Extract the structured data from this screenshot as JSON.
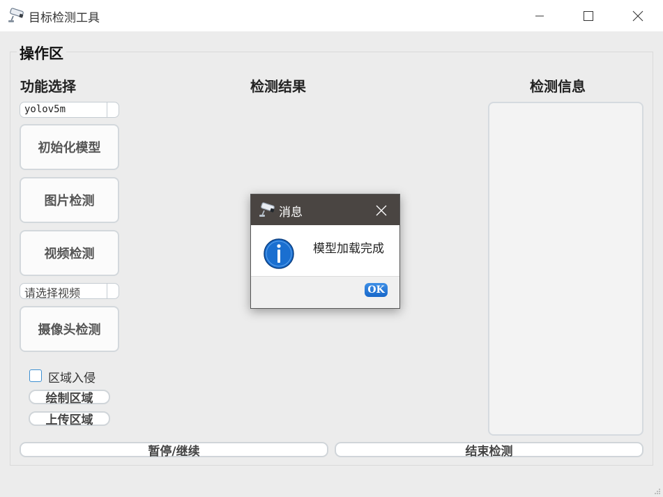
{
  "window": {
    "title": "目标检测工具",
    "icon": "security-camera-icon"
  },
  "group": {
    "title": "操作区"
  },
  "sections": {
    "function_select": "功能选择",
    "detect_result": "检测结果",
    "detect_info": "检测信息"
  },
  "controls": {
    "model_combo": "yolov5m",
    "init_model": "初始化模型",
    "image_detect": "图片检测",
    "video_detect": "视频检测",
    "video_combo": "请选择视频",
    "camera_detect": "摄像头检测",
    "area_intrusion": "区域入侵",
    "area_intrusion_checked": false,
    "draw_area": "绘制区域",
    "upload_area": "上传区域",
    "pause_resume": "暂停/继续",
    "stop_detect": "结束检测"
  },
  "dialog": {
    "title": "消息",
    "message": "模型加载完成",
    "ok": "OK",
    "icon": "info-icon"
  },
  "colors": {
    "accent": "#1767c9",
    "dialog_titlebar": "#4a4542",
    "info_icon": "#1a6fd0"
  }
}
